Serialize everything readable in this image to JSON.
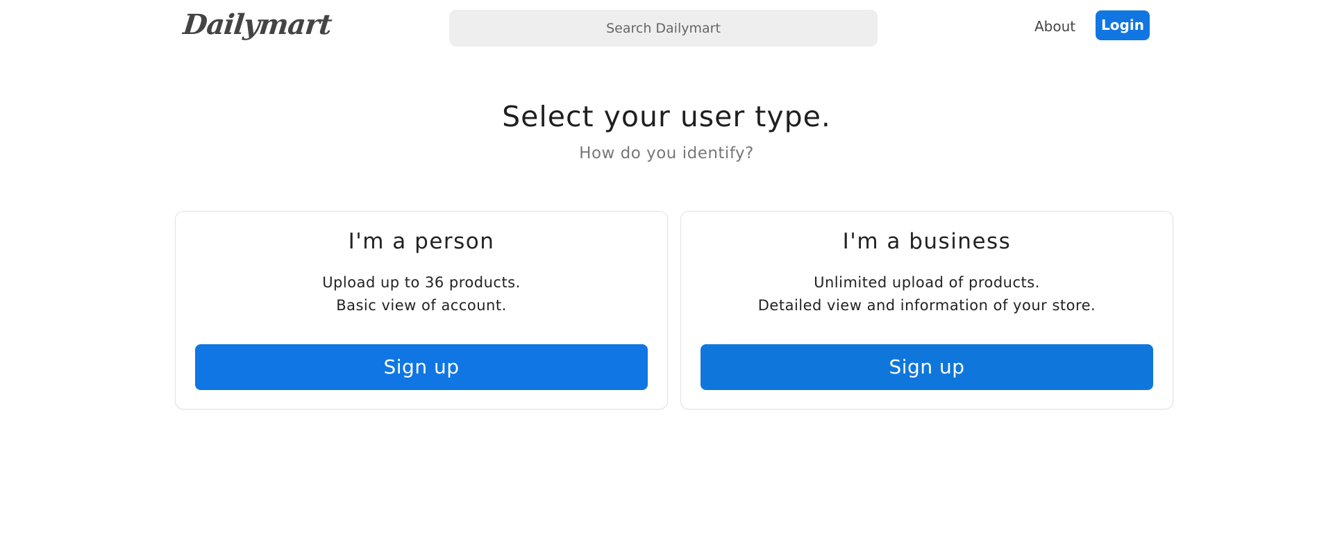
{
  "header": {
    "logo_text": "Dailymart",
    "search_placeholder": "Search Dailymart",
    "about_label": "About",
    "login_label": "Login"
  },
  "main": {
    "title": "Select your user type.",
    "subtitle": "How do you identify?",
    "cards": [
      {
        "title": "I'm a person",
        "line1": "Upload up to 36 products.",
        "line2": "Basic view of account.",
        "button_label": "Sign up"
      },
      {
        "title": "I'm a business",
        "line1": "Unlimited upload of products.",
        "line2": "Detailed view and information of your store.",
        "button_label": "Sign up"
      }
    ]
  },
  "colors": {
    "accent": "#1175e2",
    "search_bg": "#eeeeee",
    "card_border": "#e2e2e2",
    "subtitle_text": "#777777"
  }
}
